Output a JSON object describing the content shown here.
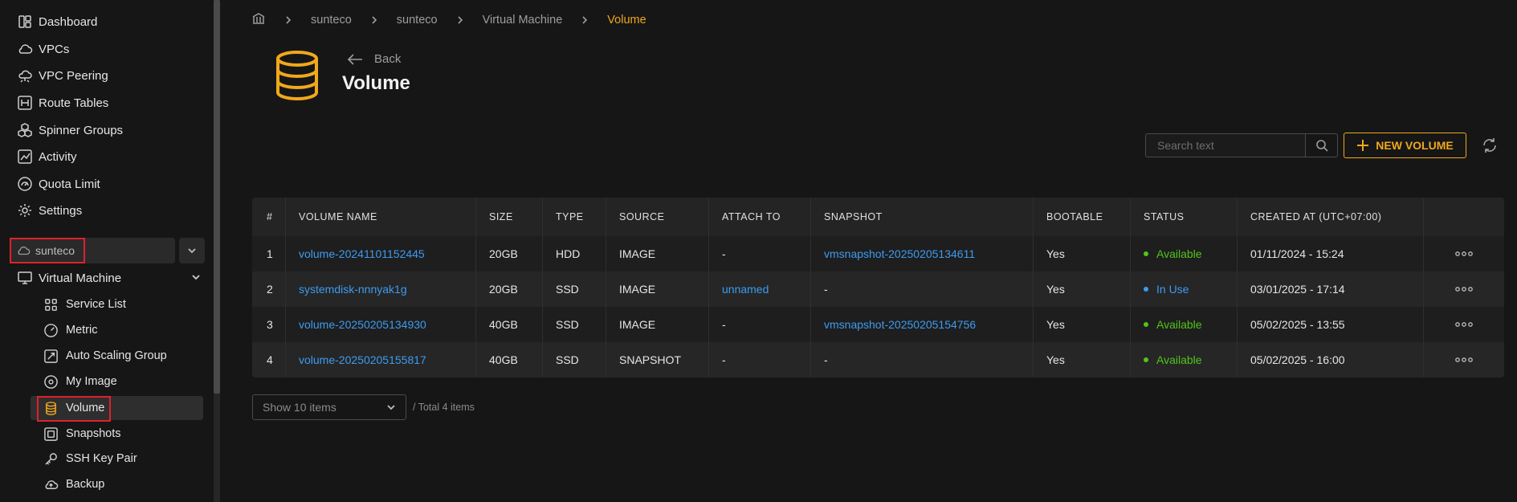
{
  "sidebar": {
    "nav": [
      {
        "label": "Dashboard",
        "icon": "dashboard-icon"
      },
      {
        "label": "VPCs",
        "icon": "cloud-icon"
      },
      {
        "label": "VPC Peering",
        "icon": "cloud-peering-icon"
      },
      {
        "label": "Route Tables",
        "icon": "route-table-icon"
      },
      {
        "label": "Spinner Groups",
        "icon": "cubes-icon"
      },
      {
        "label": "Activity",
        "icon": "activity-chart-icon"
      },
      {
        "label": "Quota Limit",
        "icon": "quota-icon"
      },
      {
        "label": "Settings",
        "icon": "gear-icon"
      }
    ],
    "project": {
      "label": "sunteco"
    },
    "group": {
      "label": "Virtual Machine"
    },
    "sub_items": [
      {
        "label": "Service List",
        "icon": "grid-icon"
      },
      {
        "label": "Metric",
        "icon": "gauge-icon"
      },
      {
        "label": "Auto Scaling Group",
        "icon": "scaling-icon"
      },
      {
        "label": "My Image",
        "icon": "disc-icon"
      },
      {
        "label": "Volume",
        "icon": "database-icon",
        "active": true
      },
      {
        "label": "Snapshots",
        "icon": "snapshot-icon"
      },
      {
        "label": "SSH Key Pair",
        "icon": "key-icon"
      },
      {
        "label": "Backup",
        "icon": "backup-cloud-icon"
      }
    ]
  },
  "breadcrumb": {
    "items": [
      "sunteco",
      "sunteco",
      "Virtual Machine"
    ],
    "current": "Volume"
  },
  "header": {
    "back_label": "Back",
    "title": "Volume"
  },
  "toolbar": {
    "search_placeholder": "Search text",
    "new_button_label": "NEW VOLUME"
  },
  "table": {
    "columns": [
      "#",
      "VOLUME NAME",
      "SIZE",
      "TYPE",
      "SOURCE",
      "ATTACH TO",
      "SNAPSHOT",
      "BOOTABLE",
      "STATUS",
      "CREATED AT (UTC+07:00)",
      ""
    ],
    "rows": [
      {
        "index": "1",
        "name": "volume-20241101152445",
        "size": "20GB",
        "type": "HDD",
        "source": "IMAGE",
        "attach_to": "-",
        "attach_link": false,
        "snapshot": "vmsnapshot-20250205134611",
        "snapshot_link": true,
        "bootable": "Yes",
        "status": "Available",
        "status_color": "#52c41a",
        "created_at": "01/11/2024 - 15:24"
      },
      {
        "index": "2",
        "name": "systemdisk-nnnyak1g",
        "size": "20GB",
        "type": "SSD",
        "source": "IMAGE",
        "attach_to": "unnamed",
        "attach_link": true,
        "snapshot": "-",
        "snapshot_link": false,
        "bootable": "Yes",
        "status": "In Use",
        "status_color": "#3d9bf0",
        "created_at": "03/01/2025 - 17:14"
      },
      {
        "index": "3",
        "name": "volume-20250205134930",
        "size": "40GB",
        "type": "SSD",
        "source": "IMAGE",
        "attach_to": "-",
        "attach_link": false,
        "snapshot": "vmsnapshot-20250205154756",
        "snapshot_link": true,
        "bootable": "Yes",
        "status": "Available",
        "status_color": "#52c41a",
        "created_at": "05/02/2025 - 13:55"
      },
      {
        "index": "4",
        "name": "volume-20250205155817",
        "size": "40GB",
        "type": "SSD",
        "source": "SNAPSHOT",
        "attach_to": "-",
        "attach_link": false,
        "snapshot": "-",
        "snapshot_link": false,
        "bootable": "Yes",
        "status": "Available",
        "status_color": "#52c41a",
        "created_at": "05/02/2025 - 16:00"
      }
    ]
  },
  "pagination": {
    "page_size_label": "Show 10 items",
    "total_label": "/ Total 4 items"
  },
  "colors": {
    "accent": "#f0a81c",
    "link": "#3d9bf0",
    "available": "#52c41a",
    "highlight_box": "#e0212b"
  }
}
